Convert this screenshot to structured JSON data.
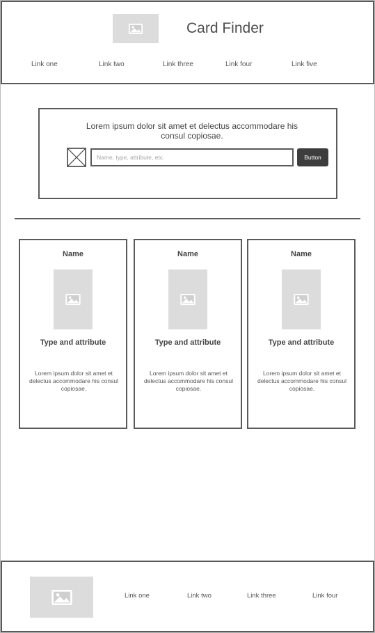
{
  "header": {
    "title": "Card Finder",
    "logo_icon": "image-placeholder-icon",
    "nav": [
      "Link one",
      "Link two",
      "Link three",
      "Link four",
      "Link five"
    ]
  },
  "search": {
    "description": "Lorem ipsum dolor sit amet et delectus accommodare his consul copiosae.",
    "placeholder": "Name, type, attribute, etc.",
    "button_label": "Button",
    "icon": "x-box-icon"
  },
  "cards": [
    {
      "name": "Name",
      "type": "Type and attribute",
      "description": "Lorem ipsum dolor sit amet et delectus accommodare his consul copiosae."
    },
    {
      "name": "Name",
      "type": "Type and attribute",
      "description": "Lorem ipsum dolor sit amet et delectus accommodare his consul copiosae."
    },
    {
      "name": "Name",
      "type": "Type and attribute",
      "description": "Lorem ipsum dolor sit amet et delectus accommodare his consul copiosae."
    }
  ],
  "footer": {
    "logo_icon": "image-placeholder-icon",
    "links": [
      "Link one",
      "Link two",
      "Link three",
      "Link four"
    ]
  },
  "colors": {
    "border": "#5a5a5a",
    "placeholder_fill": "#dcdcdc",
    "button_bg": "#3d3d3d"
  }
}
